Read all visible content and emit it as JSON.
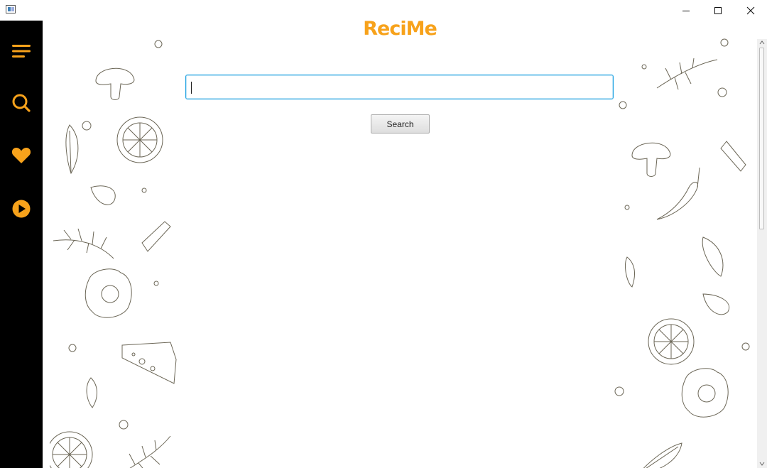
{
  "window": {
    "controls": {
      "minimize": "minimize-icon",
      "maximize": "maximize-icon",
      "close": "close-icon"
    }
  },
  "sidebar": {
    "items": [
      {
        "name": "menu",
        "icon": "menu-icon"
      },
      {
        "name": "search",
        "icon": "search-icon"
      },
      {
        "name": "favorites",
        "icon": "heart-icon"
      },
      {
        "name": "play",
        "icon": "play-icon"
      }
    ],
    "accent": "#f7a21b",
    "background": "#000000"
  },
  "header": {
    "logo": "ReciMe"
  },
  "search": {
    "value": "",
    "placeholder": "",
    "button_label": "Search"
  },
  "colors": {
    "input_focus": "#1ba1e2",
    "logo": "#f7a21b"
  }
}
